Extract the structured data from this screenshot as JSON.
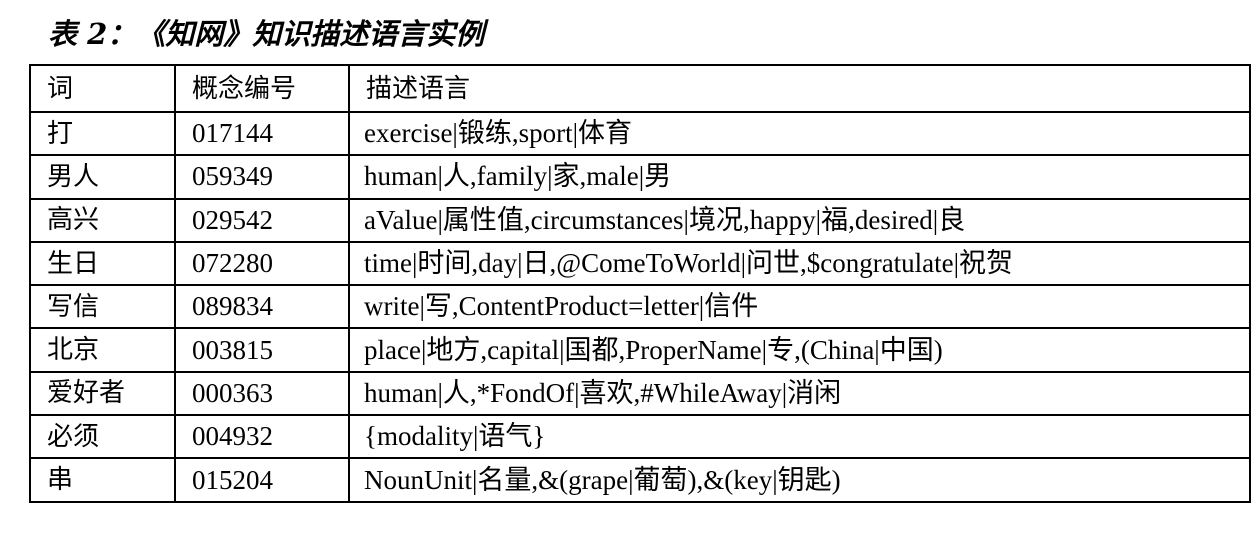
{
  "caption": "表 2：《知网》知识描述语言实例",
  "table": {
    "headers": [
      "词",
      "概念编号",
      "描述语言"
    ],
    "rows": [
      {
        "word": "打",
        "code": "017144",
        "desc": "exercise|锻练,sport|体育"
      },
      {
        "word": "男人",
        "code": "059349",
        "desc": "human|人,family|家,male|男"
      },
      {
        "word": "高兴",
        "code": "029542",
        "desc": "aValue|属性值,circumstances|境况,happy|福,desired|良"
      },
      {
        "word": "生日",
        "code": "072280",
        "desc": "time|时间,day|日,@ComeToWorld|问世,$congratulate|祝贺"
      },
      {
        "word": "写信",
        "code": "089834",
        "desc": "write|写,ContentProduct=letter|信件"
      },
      {
        "word": "北京",
        "code": "003815",
        "desc": "place|地方,capital|国都,ProperName|专,(China|中国)"
      },
      {
        "word": "爱好者",
        "code": "000363",
        "desc": "human|人,*FondOf|喜欢,#WhileAway|消闲"
      },
      {
        "word": "必须",
        "code": "004932",
        "desc": "{modality|语气}"
      },
      {
        "word": "串",
        "code": "015204",
        "desc": "NounUnit|名量,&(grape|葡萄),&(key|钥匙)"
      }
    ]
  }
}
